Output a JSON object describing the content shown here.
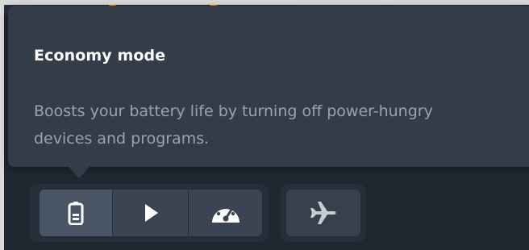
{
  "tooltip": {
    "title": "Economy mode",
    "description": "Boosts your battery life by turning off power-hungry devices and programs."
  },
  "modes": [
    {
      "icon": "battery-icon",
      "selected": true
    },
    {
      "icon": "play-icon",
      "selected": false
    },
    {
      "icon": "speedometer-icon",
      "selected": false
    }
  ],
  "airplane": {
    "icon": "airplane-icon"
  },
  "colors": {
    "tooltip_bg": "#333d49",
    "title": "#ffffff",
    "description": "#9aa3ad",
    "button": "#3a4452",
    "button_active": "#4a5565",
    "icon": "#ffffff",
    "icon_dim": "#c9ced4"
  }
}
